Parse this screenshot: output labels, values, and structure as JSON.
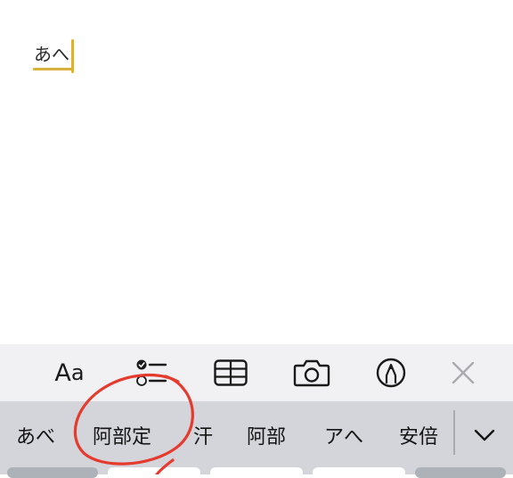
{
  "editor": {
    "composing_text": "あへ"
  },
  "toolbar": {
    "format_label_large": "A",
    "format_label_small": "a",
    "icons": [
      "checklist-icon",
      "table-icon",
      "camera-icon",
      "markup-pen-icon",
      "close-icon"
    ]
  },
  "candidates": {
    "items": [
      "あべ",
      "阿部定",
      "汗",
      "阿部",
      "アへ",
      "安倍"
    ]
  },
  "colors": {
    "caret": "#e2b321",
    "toolbar_bg": "#f1f1f3",
    "candidate_bg": "#d3d5da",
    "annotation": "#e53b2e"
  }
}
